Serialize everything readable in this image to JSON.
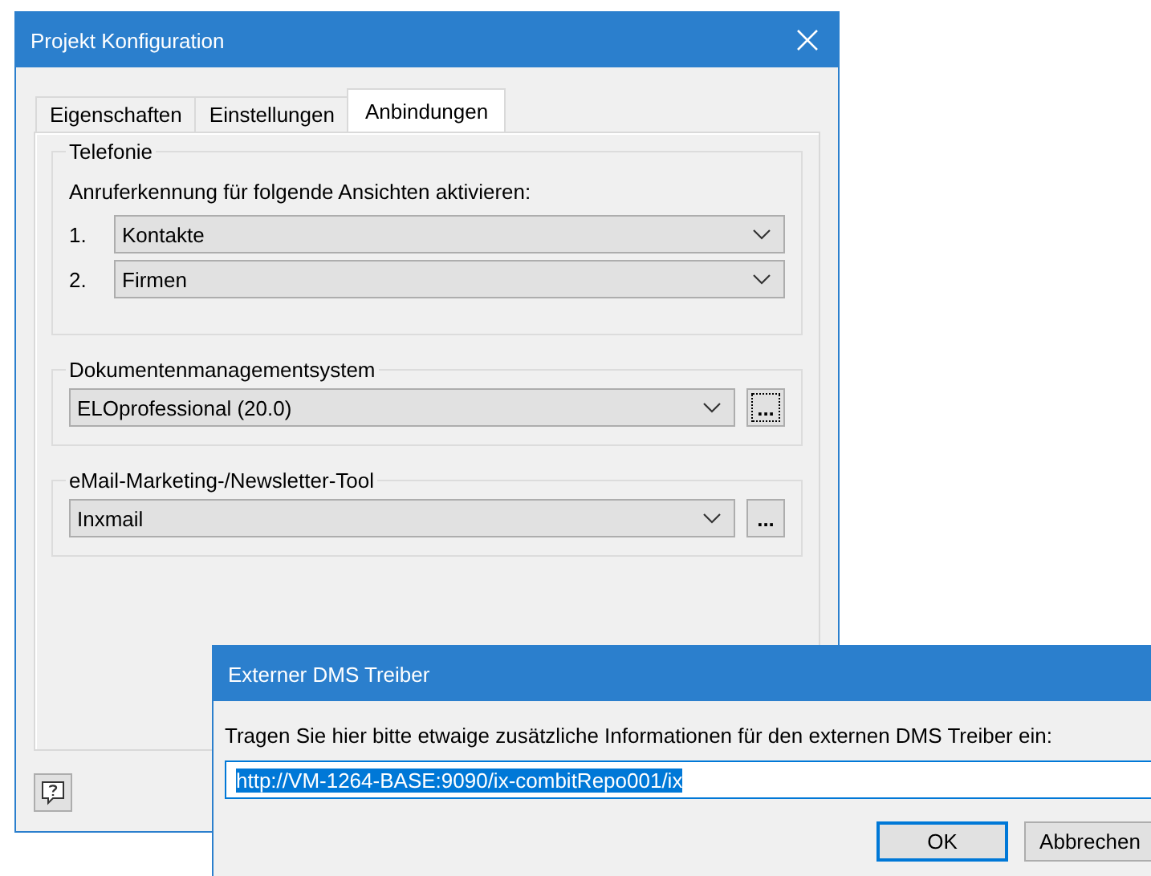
{
  "main_window": {
    "title": "Projekt Konfiguration",
    "tabs": [
      {
        "label": "Eigenschaften",
        "selected": false
      },
      {
        "label": "Einstellungen",
        "selected": false
      },
      {
        "label": "Anbindungen",
        "selected": true
      }
    ],
    "telefonie": {
      "title": "Telefonie",
      "prompt": "Anruferkennung für folgende Ansichten aktivieren:",
      "views": [
        {
          "number": "1.",
          "value": "Kontakte"
        },
        {
          "number": "2.",
          "value": "Firmen"
        }
      ]
    },
    "systems": [
      {
        "title": "Dokumentenmanagementsystem",
        "value": "ELOprofessional (20.0)",
        "button": "...",
        "focused": true
      },
      {
        "title": "eMail-Marketing-/Newsletter-Tool",
        "value": "Inxmail",
        "button": "...",
        "focused": false
      }
    ]
  },
  "driver_dialog": {
    "title": "Externer DMS Treiber",
    "prompt": "Tragen Sie hier bitte etwaige zusätzliche Informationen für den externen DMS Treiber ein:",
    "input": {
      "value": "http://VM-1264-BASE:9090/ix-combitRepo001/ix",
      "selected": true
    },
    "buttons": [
      {
        "label": "OK",
        "default": true
      },
      {
        "label": "Abbrechen",
        "default": false
      }
    ]
  }
}
